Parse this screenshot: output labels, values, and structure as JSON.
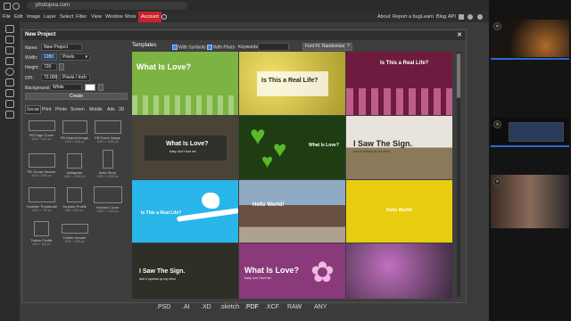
{
  "browser": {
    "url": "photopea.com"
  },
  "menu": {
    "items": [
      "File",
      "Edit",
      "Image",
      "Layer",
      "Select",
      "Filter",
      "View",
      "Window",
      "More"
    ],
    "account": "Account",
    "right": [
      "About",
      "Report a bug",
      "Learn",
      "Blog",
      "API"
    ]
  },
  "dialog": {
    "title": "New Project",
    "close": "✕",
    "name_label": "Name:",
    "name_value": "New Project",
    "width_label": "Width:",
    "width_value": "1280",
    "width_unit": "Pixels",
    "height_label": "Height:",
    "height_value": "720",
    "dpi_label": "DPI:",
    "dpi_value": "72.000",
    "dpi_unit": "Pixels / Inch",
    "bg_label": "Background:",
    "bg_value": "White",
    "create": "Create",
    "tabs": [
      "Social",
      "Print",
      "Photo",
      "Screen",
      "Mobile",
      "Ads",
      "3D"
    ],
    "presets": [
      {
        "name": "FB Page Cover",
        "size": "1640 × 624 px"
      },
      {
        "name": "FB Shared Image",
        "size": "1200 × 630 px"
      },
      {
        "name": "FB Event Image",
        "size": "1920 × 1005 px"
      },
      {
        "name": "FB Group Header",
        "size": "1640 × 856 px"
      },
      {
        "name": "Instagram",
        "size": "1080 × 1080 px"
      },
      {
        "name": "Insta Story",
        "size": "1080 × 1920 px"
      },
      {
        "name": "Youtube Thumbnail",
        "size": "1280 × 720 px"
      },
      {
        "name": "Youtube Profile",
        "size": "800 × 800 px"
      },
      {
        "name": "Youtube Cover",
        "size": "2560 × 1440 px"
      },
      {
        "name": "Twitter Profile",
        "size": "400 × 400 px"
      },
      {
        "name": "Twitter Header",
        "size": "1500 × 500 px"
      }
    ]
  },
  "templates": {
    "title": "Templates",
    "with_symbols": "With Symbols",
    "with_photo": "With Photo",
    "keywords": "Keywords:",
    "font_filter": "Font Filter ▾",
    "randomize": "Randomize",
    "help": "?",
    "tiles": [
      {
        "title": "What Is Love?",
        "sub": "",
        "bg": "#7cb342"
      },
      {
        "title": "Is This a Real Life?",
        "sub": "",
        "bg": "#d4c04a"
      },
      {
        "title": "Is This a Real Life?",
        "sub": "",
        "bg": "#6d1b3e"
      },
      {
        "title": "What Is Love?",
        "sub": "baby, don't hurt me",
        "bg": "#4a4438"
      },
      {
        "title": "What Is Love?",
        "sub": "",
        "bg": "#1e3d12"
      },
      {
        "title": "I Saw The Sign.",
        "sub": "And it opened up my mind",
        "bg": "#e8e4dc"
      },
      {
        "title": "Is This a Real Life?",
        "sub": "",
        "bg": "#29b6e8"
      },
      {
        "title": "Hello World!",
        "sub": "",
        "bg": "#8a7a6a"
      },
      {
        "title": "Hello World!",
        "sub": "",
        "bg": "#e8cc10"
      },
      {
        "title": "I Saw The Sign.",
        "sub": "And it opened up my mind",
        "bg": "#3a3a30"
      },
      {
        "title": "What Is Love?",
        "sub": "baby, don't hurt me",
        "bg": "#8a3a7a"
      },
      {
        "title": "",
        "sub": "",
        "bg": "#5a3a5a"
      }
    ]
  },
  "formats": [
    ".PSD",
    ".AI",
    ".XD",
    ".sketch",
    ".PDF",
    ".XCF",
    "RAW",
    "ANY"
  ]
}
